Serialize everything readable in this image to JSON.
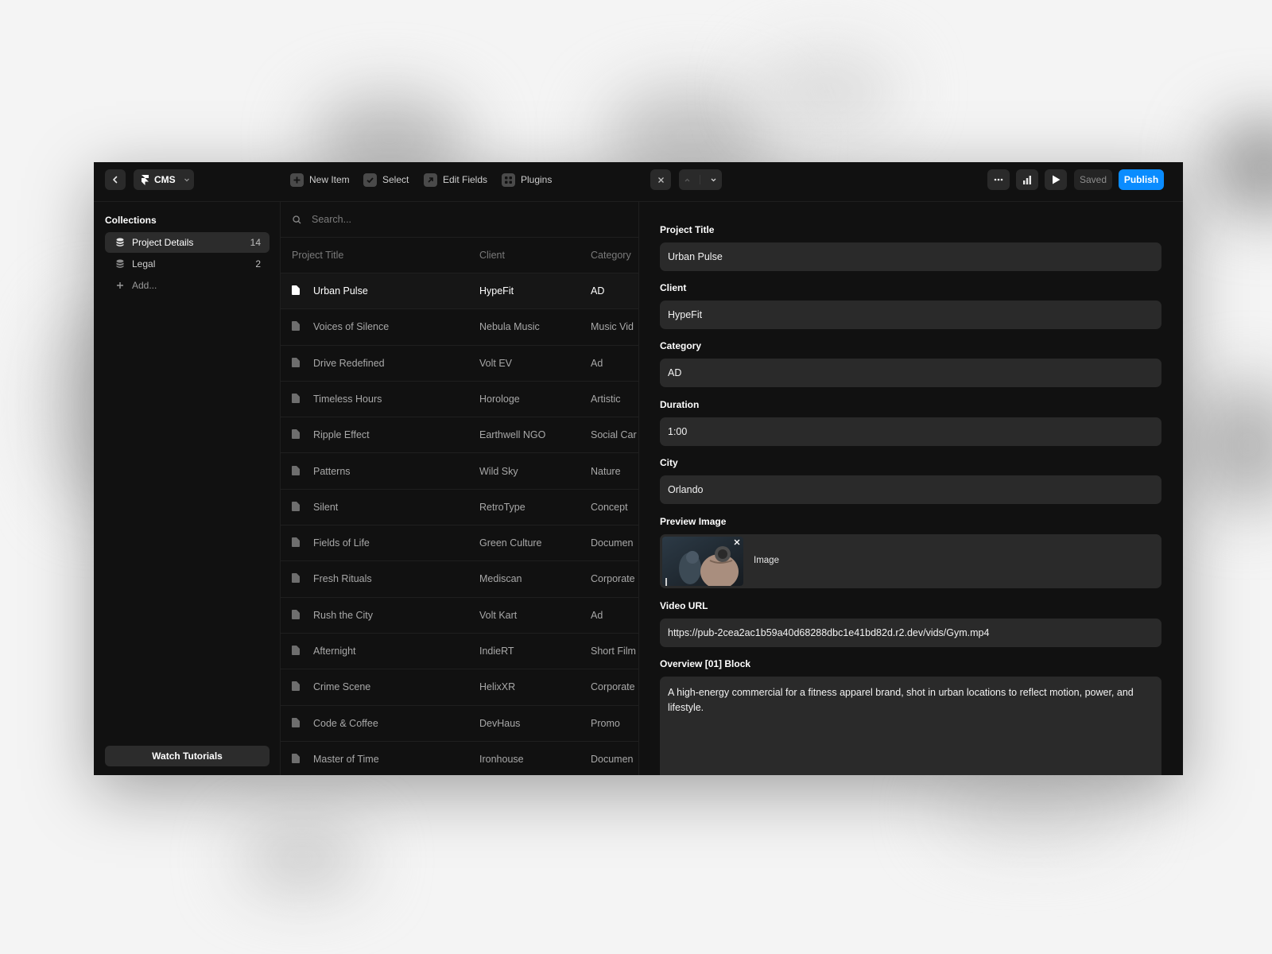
{
  "app": {
    "back_icon": "chevron-left-icon",
    "cms_label": "CMS",
    "toolbar": [
      {
        "label": "New Item",
        "icon": "plus-square-icon"
      },
      {
        "label": "Select",
        "icon": "check-square-icon"
      },
      {
        "label": "Edit Fields",
        "icon": "arrow-up-right-square-icon"
      },
      {
        "label": "Plugins",
        "icon": "plugins-grid-icon"
      }
    ]
  },
  "sidebar": {
    "heading": "Collections",
    "items": [
      {
        "label": "Project Details",
        "count": "14",
        "active": true
      },
      {
        "label": "Legal",
        "count": "2",
        "active": false
      }
    ],
    "add_label": "Add...",
    "watch_tutorials": "Watch Tutorials"
  },
  "list": {
    "search_placeholder": "Search...",
    "columns": [
      "Project Title",
      "Client",
      "Category"
    ],
    "rows": [
      [
        "Urban Pulse",
        "HypeFit",
        "AD"
      ],
      [
        "Voices of Silence",
        "Nebula Music",
        "Music Vid"
      ],
      [
        "Drive Redefined",
        "Volt EV",
        "Ad"
      ],
      [
        "Timeless Hours",
        "Horologe",
        "Artistic"
      ],
      [
        "Ripple Effect",
        "Earthwell NGO",
        "Social Car"
      ],
      [
        "Patterns",
        "Wild Sky",
        "Nature"
      ],
      [
        "Silent",
        "RetroType",
        "Concept"
      ],
      [
        "Fields of Life",
        "Green Culture",
        "Documen"
      ],
      [
        "Fresh Rituals",
        "Mediscan",
        "Corporate"
      ],
      [
        "Rush the City",
        "Volt Kart",
        "Ad"
      ],
      [
        "Afternight",
        "IndieRT",
        "Short Film"
      ],
      [
        "Crime Scene",
        "HelixXR",
        "Corporate"
      ],
      [
        "Code & Coffee",
        "DevHaus",
        "Promo"
      ],
      [
        "Master of Time",
        "Ironhouse",
        "Documen"
      ]
    ],
    "active_row": 0
  },
  "editor": {
    "saved_label": "Saved",
    "publish_label": "Publish",
    "fields": [
      {
        "label": "Project Title",
        "value": "Urban Pulse"
      },
      {
        "label": "Client",
        "value": "HypeFit"
      },
      {
        "label": "Category",
        "value": "AD"
      },
      {
        "label": "Duration",
        "value": "1:00"
      },
      {
        "label": "City",
        "value": "Orlando"
      }
    ],
    "preview": {
      "label": "Preview Image",
      "value": "Image"
    },
    "video": {
      "label": "Video URL",
      "value": "https://pub-2cea2ac1b59a40d68288dbc1e41bd82d.r2.dev/vids/Gym.mp4"
    },
    "overview": {
      "label": "Overview [01] Block",
      "value": "A high-energy commercial for a fitness apparel brand, shot in urban locations to reflect motion, power, and lifestyle."
    }
  },
  "colors": {
    "accent": "#0a8cff",
    "background": "#111111",
    "field": "#2a2a2a"
  }
}
